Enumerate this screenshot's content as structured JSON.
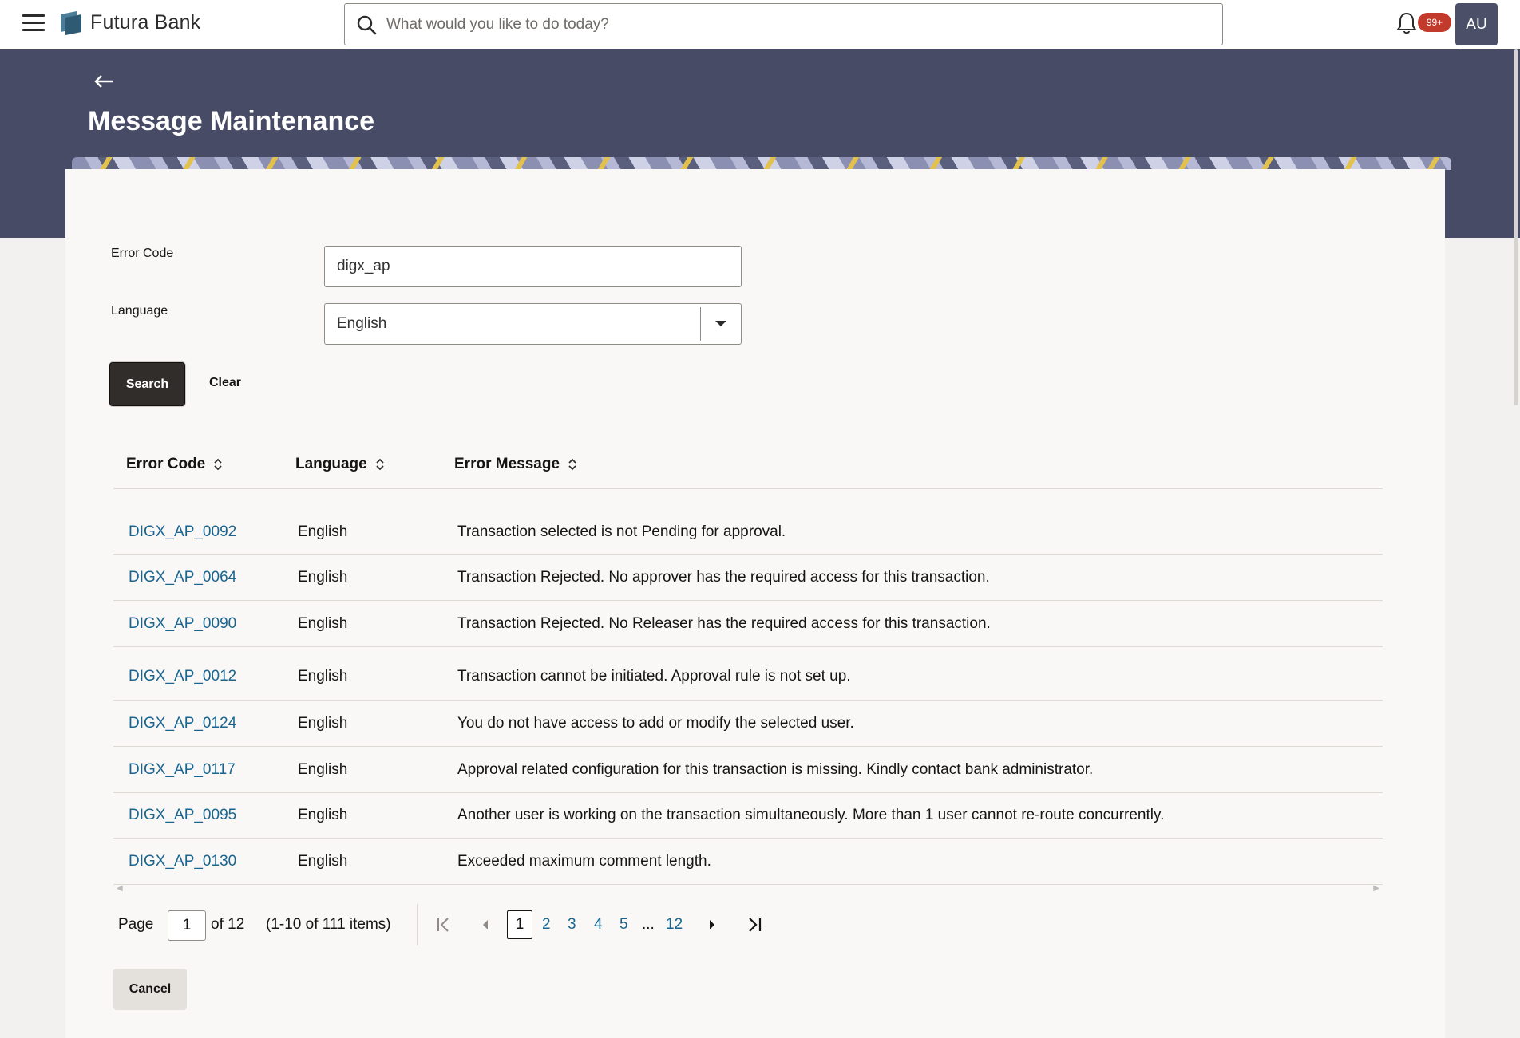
{
  "header": {
    "brand": "Futura Bank",
    "search_placeholder": "What would you like to do today?",
    "notification_badge": "99+",
    "avatar_initials": "AU"
  },
  "page": {
    "title": "Message Maintenance"
  },
  "form": {
    "error_code_label": "Error Code",
    "error_code_value": "digx_ap",
    "language_label": "Language",
    "language_value": "English",
    "search_button": "Search",
    "clear_button": "Clear"
  },
  "table": {
    "columns": [
      "Error Code",
      "Language",
      "Error Message"
    ],
    "rows": [
      {
        "code": "DIGX_AP_0092",
        "language": "English",
        "message": "Transaction selected is not Pending for approval."
      },
      {
        "code": "DIGX_AP_0064",
        "language": "English",
        "message": "Transaction Rejected. No approver has the required access for this transaction."
      },
      {
        "code": "DIGX_AP_0090",
        "language": "English",
        "message": "Transaction Rejected. No Releaser has the required access for this transaction."
      },
      {
        "code": "DIGX_AP_0012",
        "language": "English",
        "message": "Transaction cannot be initiated. Approval rule is not set up."
      },
      {
        "code": "DIGX_AP_0124",
        "language": "English",
        "message": "You do not have access to add or modify the selected user."
      },
      {
        "code": "DIGX_AP_0117",
        "language": "English",
        "message": "Approval related configuration for this transaction is missing. Kindly contact bank administrator."
      },
      {
        "code": "DIGX_AP_0095",
        "language": "English",
        "message": "Another user is working on the transaction simultaneously. More than 1 user cannot re-route concurrently."
      },
      {
        "code": "DIGX_AP_0130",
        "language": "English",
        "message": "Exceeded maximum comment length."
      }
    ]
  },
  "pagination": {
    "page_label": "Page",
    "current_page": "1",
    "of_label": "of 12",
    "items_label": "(1-10 of 111 items)",
    "pages": [
      "1",
      "2",
      "3",
      "4",
      "5"
    ],
    "ellipsis": "...",
    "last_page": "12"
  },
  "footer": {
    "cancel_button": "Cancel"
  },
  "colors": {
    "header_band": "#474b66",
    "link": "#196590",
    "primary_button": "#312d2a",
    "badge": "#c23a2b"
  }
}
